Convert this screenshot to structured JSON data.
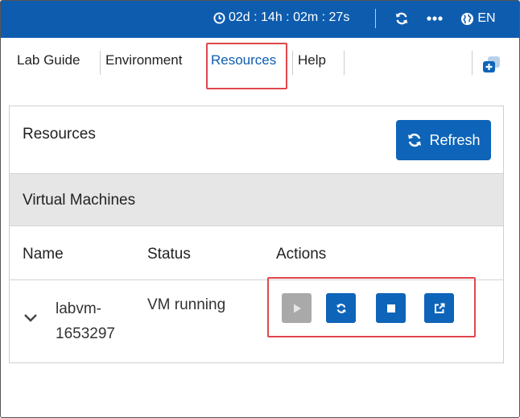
{
  "topbar": {
    "timer": "02d : 14h : 02m : 27s",
    "language": "EN",
    "icons": {
      "clock": "clock-icon",
      "refresh": "refresh-icon",
      "more": "more-dots-icon",
      "globe": "globe-icon"
    }
  },
  "tabs": [
    {
      "label": "Lab Guide",
      "active": false
    },
    {
      "label": "Environment",
      "active": false
    },
    {
      "label": "Resources",
      "active": true
    },
    {
      "label": "Help",
      "active": false
    }
  ],
  "resources": {
    "title": "Resources",
    "refresh_label": "Refresh",
    "section_title": "Virtual Machines",
    "columns": [
      "Name",
      "Status",
      "Actions"
    ],
    "vms": [
      {
        "name_line1": "labvm-",
        "name_line2": "1653297",
        "status": "VM running",
        "actions": [
          {
            "name": "start",
            "icon": "play-icon",
            "enabled": false
          },
          {
            "name": "restart",
            "icon": "refresh-icon",
            "enabled": true
          },
          {
            "name": "stop",
            "icon": "stop-icon",
            "enabled": true
          },
          {
            "name": "open",
            "icon": "external-link-icon",
            "enabled": true
          }
        ]
      }
    ]
  },
  "colors": {
    "primary": "#0e5cae",
    "button": "#0e64b8",
    "highlight": "#e0474c",
    "disabled": "#a9a9a9"
  }
}
